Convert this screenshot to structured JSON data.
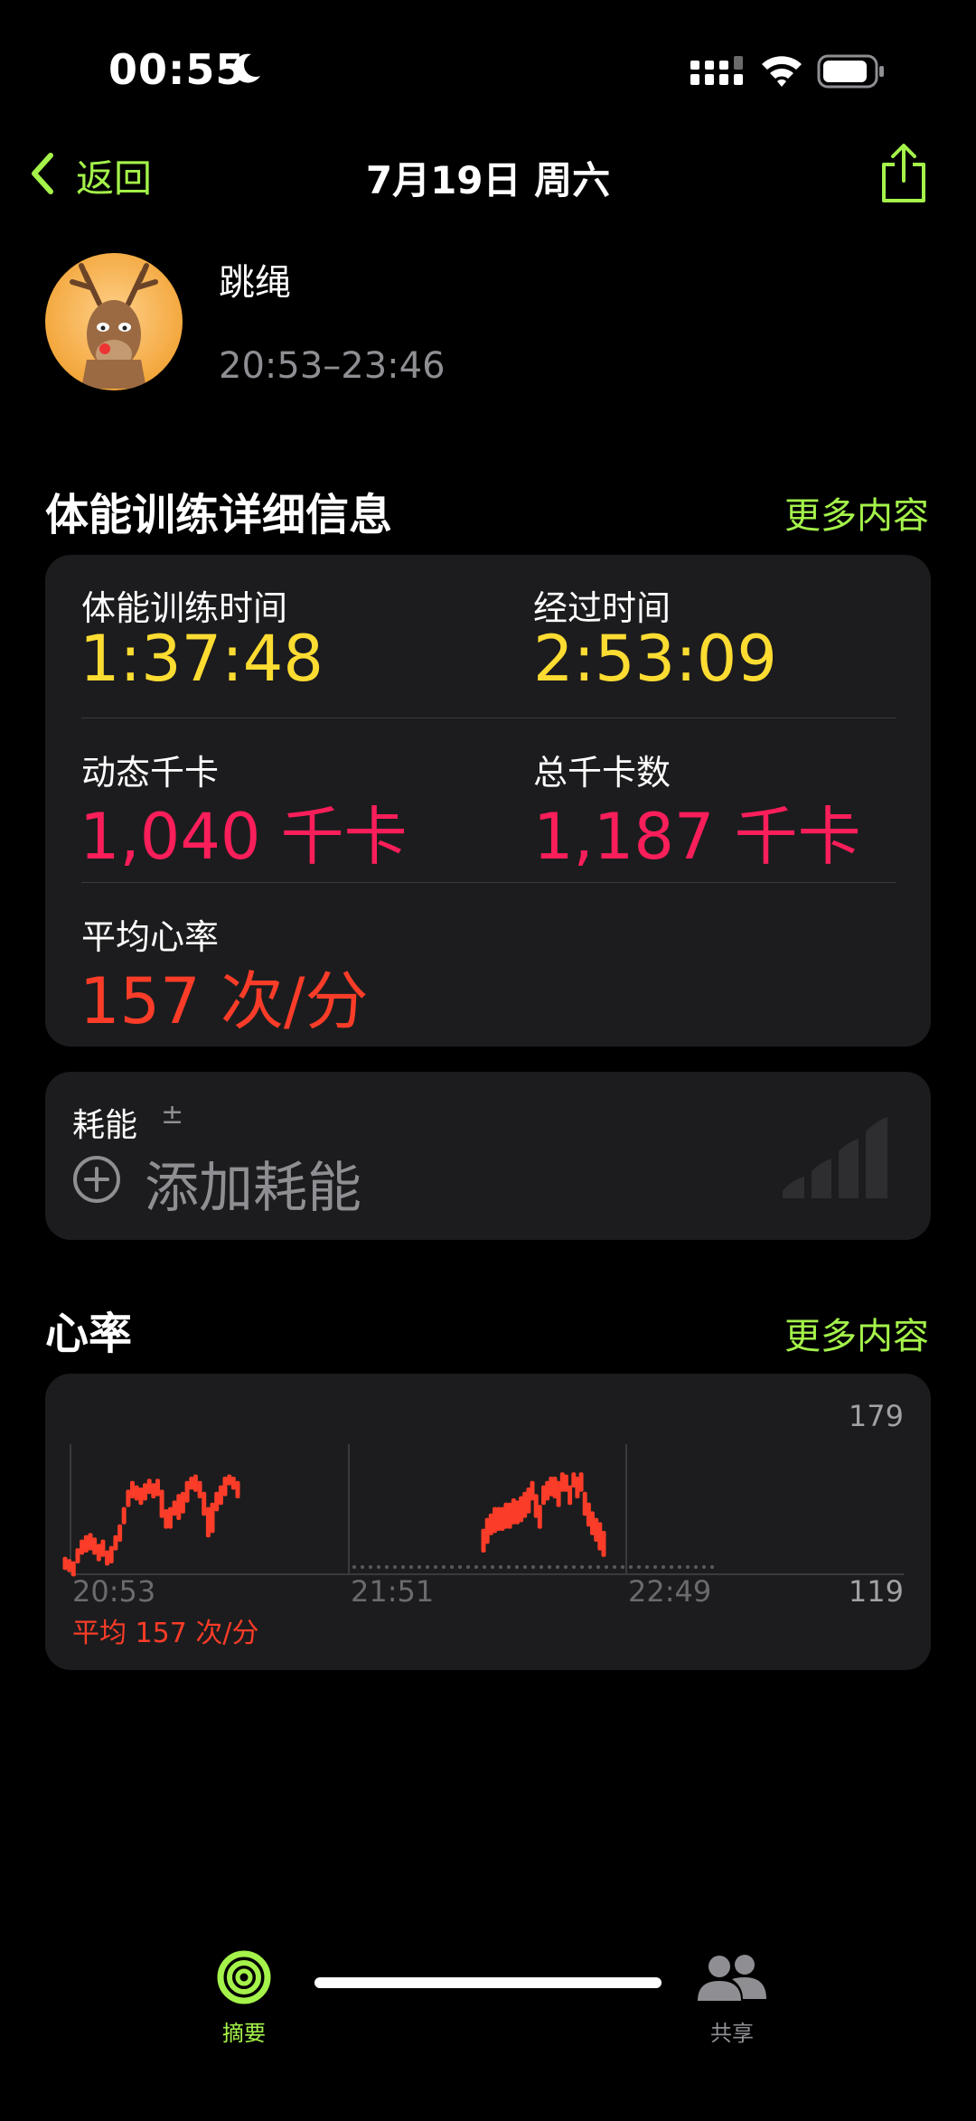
{
  "status": {
    "time": "00:55"
  },
  "nav": {
    "back_label": "返回",
    "title": "7月19日 周六"
  },
  "workout": {
    "name": "跳绳",
    "time_range": "20:53–23:46"
  },
  "details": {
    "section_title": "体能训练详细信息",
    "more_label": "更多内容",
    "workout_time_label": "体能训练时间",
    "workout_time_value": "1:37:48",
    "elapsed_label": "经过时间",
    "elapsed_value": "2:53:09",
    "active_kcal_label": "动态千卡",
    "active_kcal_value": "1,040 千卡",
    "total_kcal_label": "总千卡数",
    "total_kcal_value": "1,187 千卡",
    "avg_hr_label": "平均心率",
    "avg_hr_value": "157 次/分"
  },
  "effort": {
    "label": "耗能",
    "pm": "±",
    "add_label": "添加耗能"
  },
  "heart_rate": {
    "section_title": "心率",
    "more_label": "更多内容",
    "max_label": "179",
    "min_label": "119",
    "x_labels": [
      "20:53",
      "21:51",
      "22:49"
    ],
    "avg_label": "平均 157 次/分"
  },
  "colors": {
    "accent": "#a4f24a",
    "yellow": "#fddc32",
    "pink": "#fa1e5a",
    "red": "#fa3c28",
    "card": "#1c1c1e"
  },
  "tabs": [
    {
      "label": "摘要",
      "icon": "activity-rings-icon",
      "active": true
    },
    {
      "label": "共享",
      "icon": "people-icon",
      "active": false
    }
  ],
  "chart_data": {
    "type": "bar",
    "ylim": [
      119,
      179
    ],
    "x_ticks": [
      "20:53",
      "21:51",
      "22:49"
    ],
    "series": [
      {
        "values": [
          [
            127,
            121
          ],
          [
            126,
            120
          ],
          [
            125,
            118
          ],
          [
            131,
            124
          ],
          [
            135,
            128
          ],
          [
            137,
            129
          ],
          [
            138,
            130
          ],
          [
            136,
            128
          ],
          [
            133,
            125
          ],
          [
            135,
            127
          ],
          [
            130,
            123
          ],
          [
            132,
            124
          ],
          [
            137,
            130
          ],
          [
            142,
            134
          ],
          [
            150,
            142
          ],
          [
            158,
            150
          ],
          [
            162,
            154
          ],
          [
            160,
            153
          ],
          [
            159,
            151
          ],
          [
            161,
            153
          ],
          [
            163,
            156
          ],
          [
            161,
            154
          ],
          [
            163,
            155
          ],
          [
            158,
            145
          ],
          [
            149,
            140
          ],
          [
            150,
            140
          ],
          [
            153,
            146
          ],
          [
            156,
            144
          ],
          [
            157,
            147
          ],
          [
            162,
            152
          ],
          [
            164,
            158
          ],
          [
            165,
            157
          ],
          [
            162,
            154
          ],
          [
            157,
            146
          ],
          [
            150,
            136
          ],
          [
            152,
            138
          ],
          [
            157,
            148
          ],
          [
            160,
            151
          ],
          [
            164,
            155
          ],
          [
            165,
            160
          ],
          [
            164,
            158
          ],
          [
            162,
            154
          ]
        ]
      },
      {
        "values": [
          [
            140,
            129
          ],
          [
            145,
            133
          ],
          [
            147,
            137
          ],
          [
            150,
            138
          ],
          [
            150,
            139
          ],
          [
            150,
            139
          ],
          [
            152,
            140
          ],
          [
            152,
            140
          ],
          [
            154,
            142
          ],
          [
            153,
            142
          ],
          [
            155,
            143
          ],
          [
            157,
            145
          ],
          [
            159,
            147
          ],
          [
            162,
            153
          ],
          [
            156,
            145
          ],
          [
            151,
            140
          ],
          [
            160,
            151
          ],
          [
            162,
            153
          ],
          [
            164,
            155
          ],
          [
            164,
            154
          ],
          [
            162,
            150
          ],
          [
            166,
            157
          ],
          [
            165,
            157
          ],
          [
            160,
            151
          ],
          [
            166,
            159
          ],
          [
            164,
            154
          ],
          [
            166,
            157
          ],
          [
            157,
            146
          ],
          [
            152,
            141
          ],
          [
            148,
            137
          ],
          [
            145,
            134
          ],
          [
            143,
            130
          ],
          [
            139,
            127
          ]
        ]
      }
    ]
  }
}
